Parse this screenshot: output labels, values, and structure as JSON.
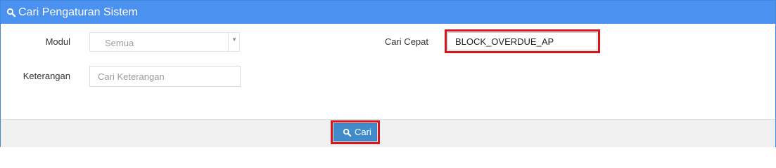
{
  "panel": {
    "title": "Cari Pengaturan Sistem",
    "icon": "search-icon"
  },
  "form": {
    "modul_label": "Modul",
    "modul_value": "Semua",
    "keterangan_label": "Keterangan",
    "keterangan_placeholder": "Cari Keterangan",
    "cari_cepat_label": "Cari Cepat",
    "cari_cepat_value": "BLOCK_OVERDUE_AP"
  },
  "footer": {
    "search_button_label": "Cari",
    "search_button_icon": "search-icon"
  },
  "colors": {
    "header_bg": "#4a91f0",
    "button_bg": "#428bca",
    "highlight": "#d8141c"
  }
}
